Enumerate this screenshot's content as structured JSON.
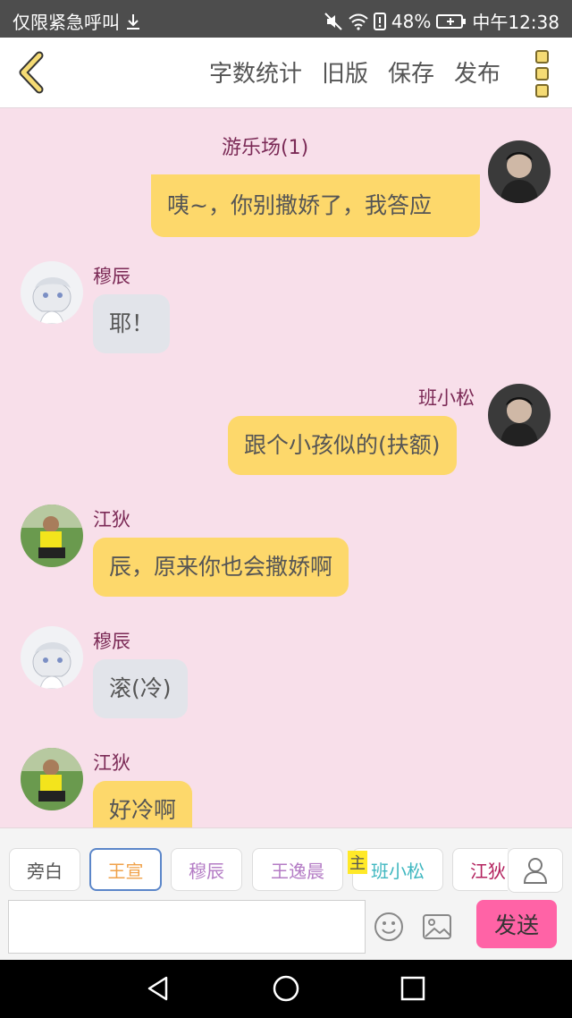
{
  "status": {
    "left_text": "仅限紧急呼叫",
    "battery": "48%",
    "time": "中午12:38"
  },
  "toolbar": {
    "actions": [
      "字数统计",
      "旧版",
      "保存",
      "发布"
    ]
  },
  "chat": {
    "room_title": "游乐场(1)",
    "messages": [
      {
        "sender": "",
        "text": "咦~，你别撒娇了，我答应",
        "side": "right"
      },
      {
        "sender": "穆辰",
        "text": "耶！",
        "side": "left"
      },
      {
        "sender": "班小松",
        "text": "跟个小孩似的(扶额)",
        "side": "right"
      },
      {
        "sender": "江狄",
        "text": "辰，原来你也会撒娇啊",
        "side": "left"
      },
      {
        "sender": "穆辰",
        "text": "滚(冷)",
        "side": "left"
      },
      {
        "sender": "江狄",
        "text": "好冷啊",
        "side": "left"
      }
    ]
  },
  "character_tabs": [
    {
      "label": "旁白",
      "color": "#555555"
    },
    {
      "label": "王宣",
      "color": "#f0a24a"
    },
    {
      "label": "穆辰",
      "color": "#b47cc5"
    },
    {
      "label": "王逸晨",
      "color": "#b47cc5"
    },
    {
      "label": "班小松",
      "color": "#3fb7c0"
    },
    {
      "label": "江狄",
      "color": "#b3215d"
    }
  ],
  "host_badge": "主",
  "composer": {
    "send_label": "发送"
  }
}
